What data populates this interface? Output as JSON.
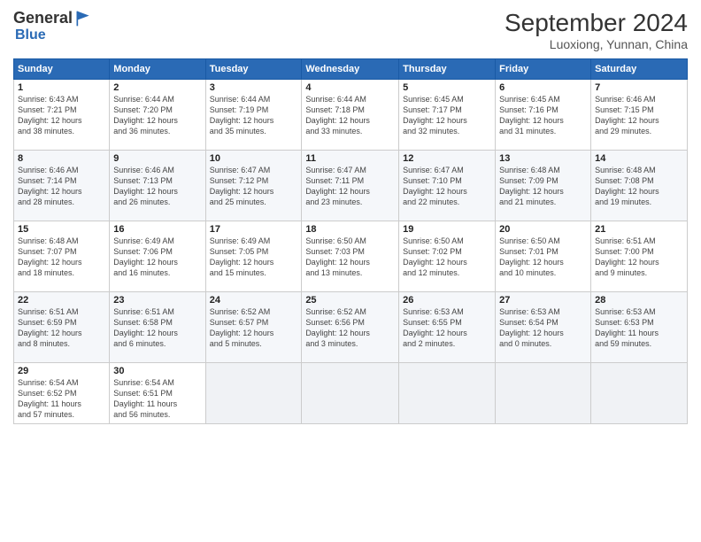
{
  "header": {
    "logo_general": "General",
    "logo_blue": "Blue",
    "month_year": "September 2024",
    "location": "Luoxiong, Yunnan, China"
  },
  "weekdays": [
    "Sunday",
    "Monday",
    "Tuesday",
    "Wednesday",
    "Thursday",
    "Friday",
    "Saturday"
  ],
  "weeks": [
    [
      {
        "day": "1",
        "info": "Sunrise: 6:43 AM\nSunset: 7:21 PM\nDaylight: 12 hours\nand 38 minutes."
      },
      {
        "day": "2",
        "info": "Sunrise: 6:44 AM\nSunset: 7:20 PM\nDaylight: 12 hours\nand 36 minutes."
      },
      {
        "day": "3",
        "info": "Sunrise: 6:44 AM\nSunset: 7:19 PM\nDaylight: 12 hours\nand 35 minutes."
      },
      {
        "day": "4",
        "info": "Sunrise: 6:44 AM\nSunset: 7:18 PM\nDaylight: 12 hours\nand 33 minutes."
      },
      {
        "day": "5",
        "info": "Sunrise: 6:45 AM\nSunset: 7:17 PM\nDaylight: 12 hours\nand 32 minutes."
      },
      {
        "day": "6",
        "info": "Sunrise: 6:45 AM\nSunset: 7:16 PM\nDaylight: 12 hours\nand 31 minutes."
      },
      {
        "day": "7",
        "info": "Sunrise: 6:46 AM\nSunset: 7:15 PM\nDaylight: 12 hours\nand 29 minutes."
      }
    ],
    [
      {
        "day": "8",
        "info": "Sunrise: 6:46 AM\nSunset: 7:14 PM\nDaylight: 12 hours\nand 28 minutes."
      },
      {
        "day": "9",
        "info": "Sunrise: 6:46 AM\nSunset: 7:13 PM\nDaylight: 12 hours\nand 26 minutes."
      },
      {
        "day": "10",
        "info": "Sunrise: 6:47 AM\nSunset: 7:12 PM\nDaylight: 12 hours\nand 25 minutes."
      },
      {
        "day": "11",
        "info": "Sunrise: 6:47 AM\nSunset: 7:11 PM\nDaylight: 12 hours\nand 23 minutes."
      },
      {
        "day": "12",
        "info": "Sunrise: 6:47 AM\nSunset: 7:10 PM\nDaylight: 12 hours\nand 22 minutes."
      },
      {
        "day": "13",
        "info": "Sunrise: 6:48 AM\nSunset: 7:09 PM\nDaylight: 12 hours\nand 21 minutes."
      },
      {
        "day": "14",
        "info": "Sunrise: 6:48 AM\nSunset: 7:08 PM\nDaylight: 12 hours\nand 19 minutes."
      }
    ],
    [
      {
        "day": "15",
        "info": "Sunrise: 6:48 AM\nSunset: 7:07 PM\nDaylight: 12 hours\nand 18 minutes."
      },
      {
        "day": "16",
        "info": "Sunrise: 6:49 AM\nSunset: 7:06 PM\nDaylight: 12 hours\nand 16 minutes."
      },
      {
        "day": "17",
        "info": "Sunrise: 6:49 AM\nSunset: 7:05 PM\nDaylight: 12 hours\nand 15 minutes."
      },
      {
        "day": "18",
        "info": "Sunrise: 6:50 AM\nSunset: 7:03 PM\nDaylight: 12 hours\nand 13 minutes."
      },
      {
        "day": "19",
        "info": "Sunrise: 6:50 AM\nSunset: 7:02 PM\nDaylight: 12 hours\nand 12 minutes."
      },
      {
        "day": "20",
        "info": "Sunrise: 6:50 AM\nSunset: 7:01 PM\nDaylight: 12 hours\nand 10 minutes."
      },
      {
        "day": "21",
        "info": "Sunrise: 6:51 AM\nSunset: 7:00 PM\nDaylight: 12 hours\nand 9 minutes."
      }
    ],
    [
      {
        "day": "22",
        "info": "Sunrise: 6:51 AM\nSunset: 6:59 PM\nDaylight: 12 hours\nand 8 minutes."
      },
      {
        "day": "23",
        "info": "Sunrise: 6:51 AM\nSunset: 6:58 PM\nDaylight: 12 hours\nand 6 minutes."
      },
      {
        "day": "24",
        "info": "Sunrise: 6:52 AM\nSunset: 6:57 PM\nDaylight: 12 hours\nand 5 minutes."
      },
      {
        "day": "25",
        "info": "Sunrise: 6:52 AM\nSunset: 6:56 PM\nDaylight: 12 hours\nand 3 minutes."
      },
      {
        "day": "26",
        "info": "Sunrise: 6:53 AM\nSunset: 6:55 PM\nDaylight: 12 hours\nand 2 minutes."
      },
      {
        "day": "27",
        "info": "Sunrise: 6:53 AM\nSunset: 6:54 PM\nDaylight: 12 hours\nand 0 minutes."
      },
      {
        "day": "28",
        "info": "Sunrise: 6:53 AM\nSunset: 6:53 PM\nDaylight: 11 hours\nand 59 minutes."
      }
    ],
    [
      {
        "day": "29",
        "info": "Sunrise: 6:54 AM\nSunset: 6:52 PM\nDaylight: 11 hours\nand 57 minutes."
      },
      {
        "day": "30",
        "info": "Sunrise: 6:54 AM\nSunset: 6:51 PM\nDaylight: 11 hours\nand 56 minutes."
      },
      {
        "day": "",
        "info": ""
      },
      {
        "day": "",
        "info": ""
      },
      {
        "day": "",
        "info": ""
      },
      {
        "day": "",
        "info": ""
      },
      {
        "day": "",
        "info": ""
      }
    ]
  ]
}
